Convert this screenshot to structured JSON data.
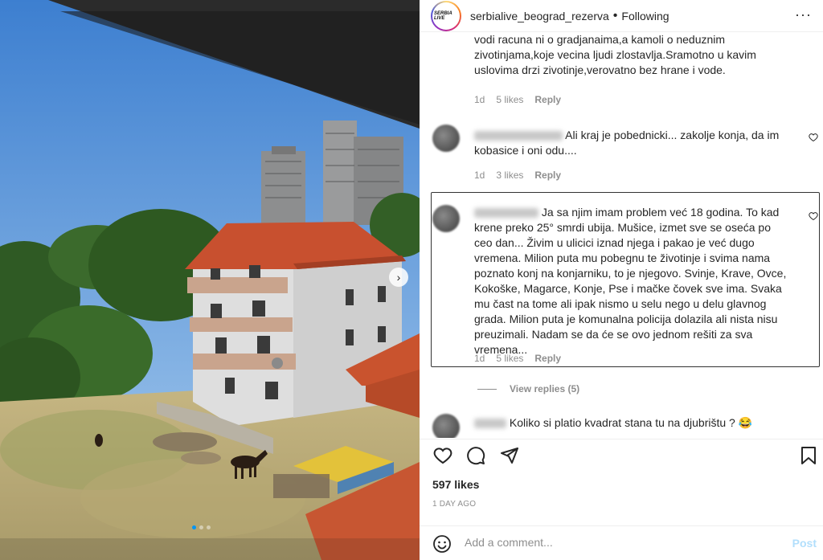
{
  "post": {
    "username": "serbialive_beograd_rezerva",
    "separator": "•",
    "follow_status": "Following",
    "avatar_text": "SERBIA LIVE",
    "more_icon": "more-horizontal-icon",
    "likes": "597 likes",
    "time_ago": "1 DAY AGO",
    "carousel": {
      "total": 3,
      "active_index": 0
    }
  },
  "comments": [
    {
      "text": "vodi racuna ni o gradjanaima,a kamoli o neduznim zivotinjama,koje vecina ljudi zlostavlja.Sramotno u kavim uslovima drzi zivotinje,verovatno bez hrane i vode.",
      "age": "1d",
      "likes": "5 likes",
      "reply": "Reply"
    },
    {
      "text": "Ali kraj je pobednicki... zakolje konja, da im kobasice i oni odu....",
      "age": "1d",
      "likes": "3 likes",
      "reply": "Reply"
    },
    {
      "text": "Ja sa njim imam problem već 18 godina. To kad krene preko 25° smrdi ubija. Mušice, izmet sve se oseća po ceo dan... Živim u ulicici iznad njega i pakao je već dugo vremena. Milion puta mu pobegnu te životinje i svima nama poznato konj na konjarniku, to je njegovo. Svinje, Krave, Ovce, Kokoške, Magarce, Konje, Pse i mačke čovek sve ima. Svaka mu čast na tome ali ipak nismo u selu nego u delu glavnog grada. Milion puta je komunalna policija dolazila ali nista nisu preuzimali. Nadam se da će se ovo jednom rešiti za sva vremena...",
      "age": "1d",
      "likes": "5 likes",
      "reply": "Reply"
    },
    {
      "text": "Koliko si platio kvadrat stana tu na djubrištu ? 😂"
    }
  ],
  "view_replies": "View replies (5)",
  "comment_box": {
    "placeholder": "Add a comment...",
    "post_label": "Post"
  },
  "colors": {
    "accent": "#0095f6",
    "post_disabled": "#b2dffc",
    "meta": "#8e8e8e"
  }
}
